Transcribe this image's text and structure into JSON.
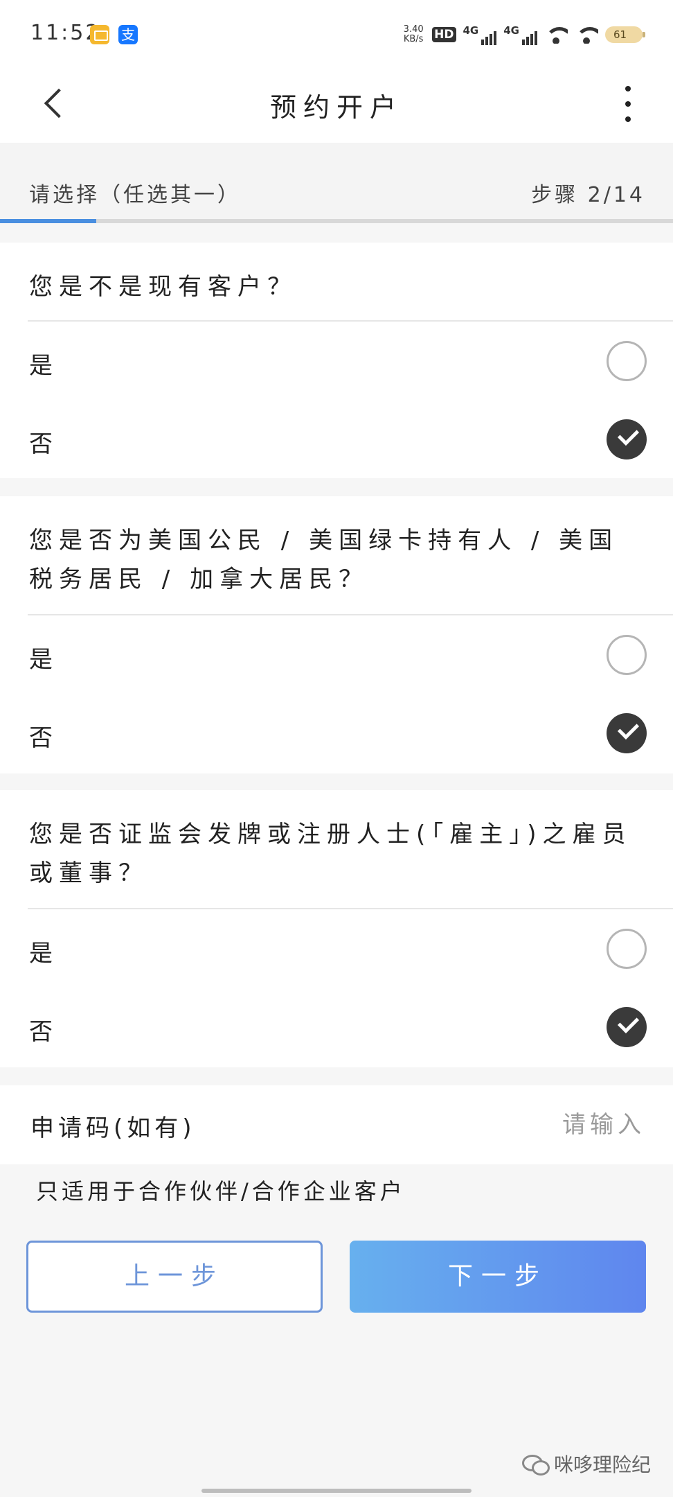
{
  "status_bar": {
    "time": "11:52",
    "net_speed": "3.40",
    "net_speed_unit": "KB/s",
    "hd_label": "HD",
    "network_1": "4G",
    "network_2": "4G",
    "battery": "61",
    "app_icons": [
      "mail-icon",
      "alipay-icon"
    ]
  },
  "nav": {
    "title": "预约开户"
  },
  "step": {
    "label": "请选择（任选其一）",
    "counter": "步骤 2/14",
    "current": 2,
    "total": 14
  },
  "questions": [
    {
      "text": "您是不是现有客户？",
      "options": [
        {
          "label": "是",
          "selected": false
        },
        {
          "label": "否",
          "selected": true
        }
      ]
    },
    {
      "text": "您是否为美国公民 / 美国绿卡持有人 / 美国税务居民 / 加拿大居民？",
      "options": [
        {
          "label": "是",
          "selected": false
        },
        {
          "label": "否",
          "selected": true
        }
      ]
    },
    {
      "text": "您是否证监会发牌或注册人士(「雇主」)之雇员或董事？",
      "options": [
        {
          "label": "是",
          "selected": false
        },
        {
          "label": "否",
          "selected": true
        }
      ]
    }
  ],
  "application_code": {
    "label": "申请码(如有)",
    "placeholder": "请输入",
    "value": ""
  },
  "note": "只适用于合作伙伴/合作企业客户",
  "buttons": {
    "prev": "上一步",
    "next": "下一步"
  },
  "watermark": "咪哆理险纪",
  "colors": {
    "accent": "#4a8fe0",
    "checked": "#3a3a3a",
    "next_gradient_start": "#67b0ee",
    "next_gradient_end": "#5f86ee"
  }
}
